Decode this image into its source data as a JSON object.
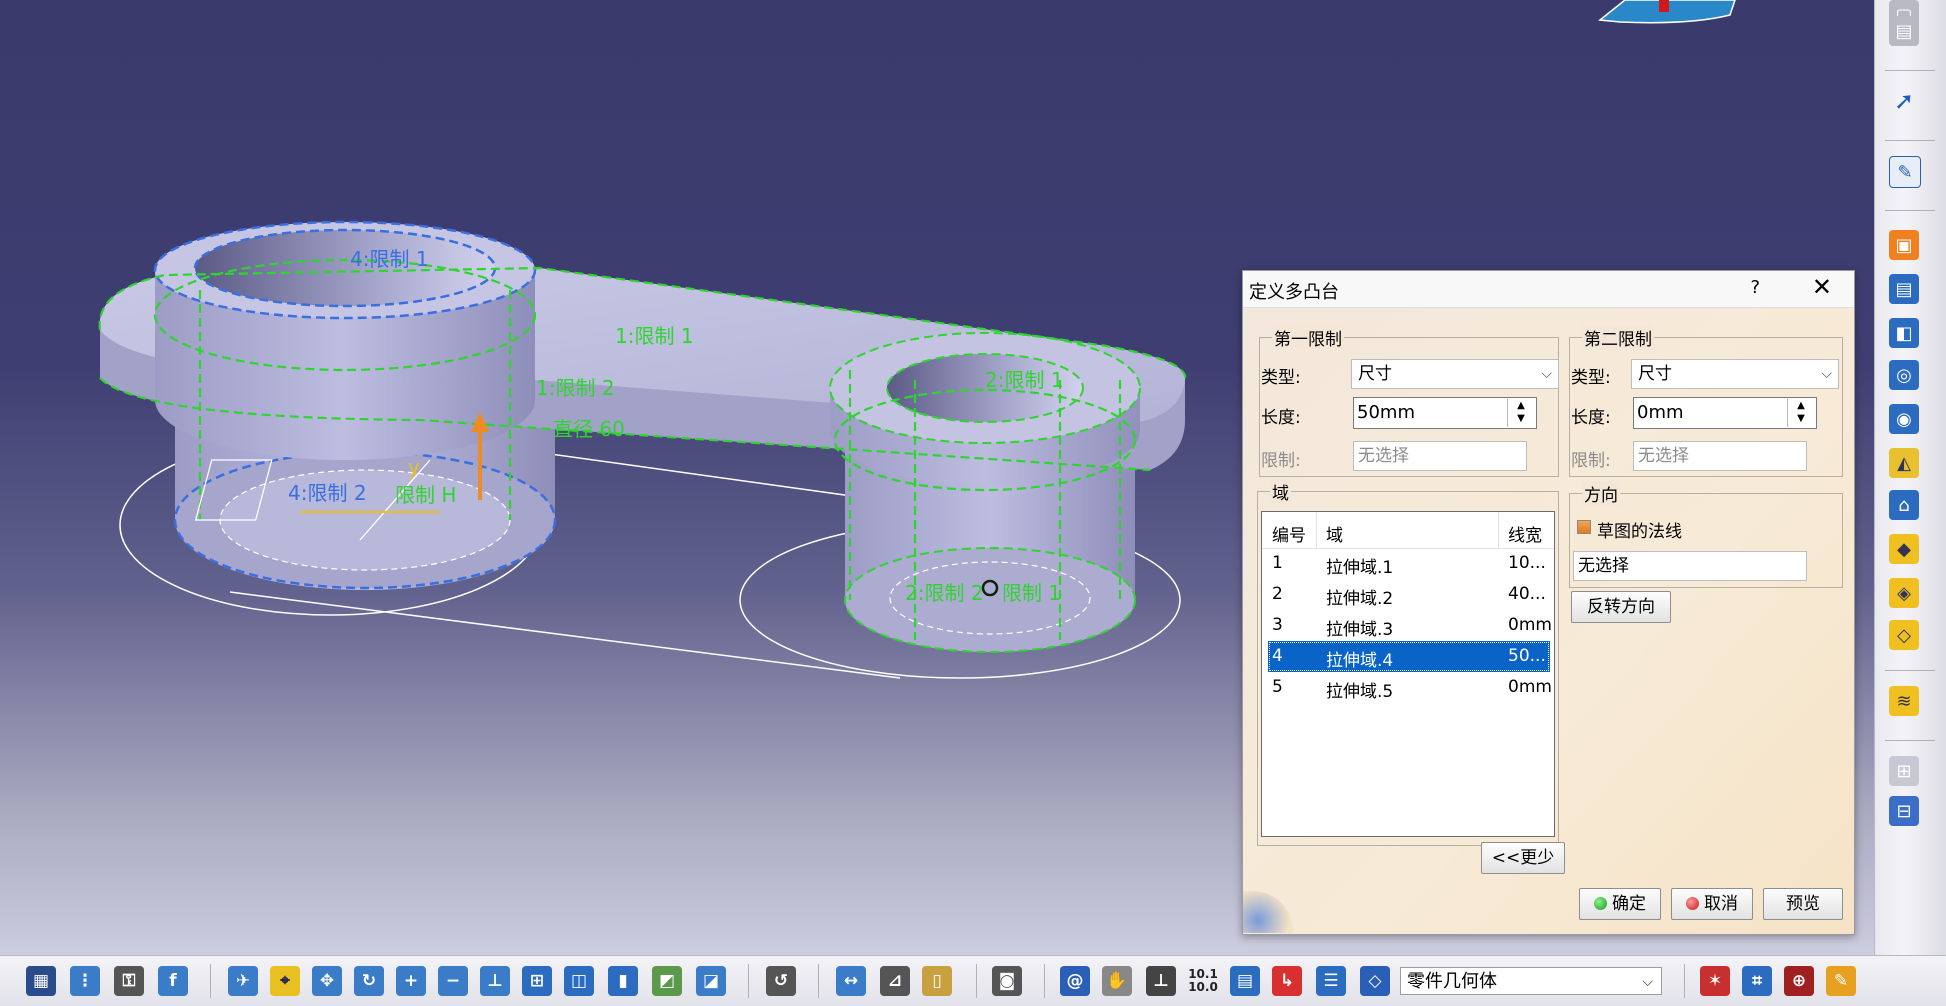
{
  "viewport": {
    "labels": {
      "l1": "4:限制 1",
      "l2": "1:限制 1",
      "l3": "1:限制 2",
      "l4": "直径 60",
      "l5": "2:限制 1",
      "l6": "4:限制 2",
      "l7": "限制 H",
      "l8": "2:限制 2",
      "l9": "限制 1",
      "axis_y": "y"
    }
  },
  "dialog": {
    "title": "定义多凸台",
    "help": "?",
    "close": "✕",
    "first_limit": {
      "group": "第一限制",
      "type_label": "类型:",
      "type_value": "尺寸",
      "length_label": "长度:",
      "length_value": "50mm",
      "limit_label": "限制:",
      "limit_value": "无选择"
    },
    "second_limit": {
      "group": "第二限制",
      "type_label": "类型:",
      "type_value": "尺寸",
      "length_label": "长度:",
      "length_value": "0mm",
      "limit_label": "限制:",
      "limit_value": "无选择"
    },
    "domains": {
      "group": "域",
      "headers": {
        "num": "编号",
        "domain": "域",
        "thickness": "线宽"
      },
      "rows": [
        {
          "num": "1",
          "domain": "拉伸域.1",
          "thickness": "10..."
        },
        {
          "num": "2",
          "domain": "拉伸域.2",
          "thickness": "40..."
        },
        {
          "num": "3",
          "domain": "拉伸域.3",
          "thickness": "0mm"
        },
        {
          "num": "4",
          "domain": "拉伸域.4",
          "thickness": "50..."
        },
        {
          "num": "5",
          "domain": "拉伸域.5",
          "thickness": "0mm"
        }
      ],
      "selected_index": 4
    },
    "direction": {
      "group": "方向",
      "normal_label": "草图的法线",
      "normal_checked": true,
      "selection": "无选择",
      "reverse_button": "反转方向"
    },
    "less_button": "<<更少",
    "ok_button": "确定",
    "cancel_button": "取消",
    "preview_button": "预览"
  },
  "bottom_bar": {
    "body_select": "零件几何体",
    "scale_label_top": "10.1",
    "scale_label_bottom": "10.0"
  }
}
